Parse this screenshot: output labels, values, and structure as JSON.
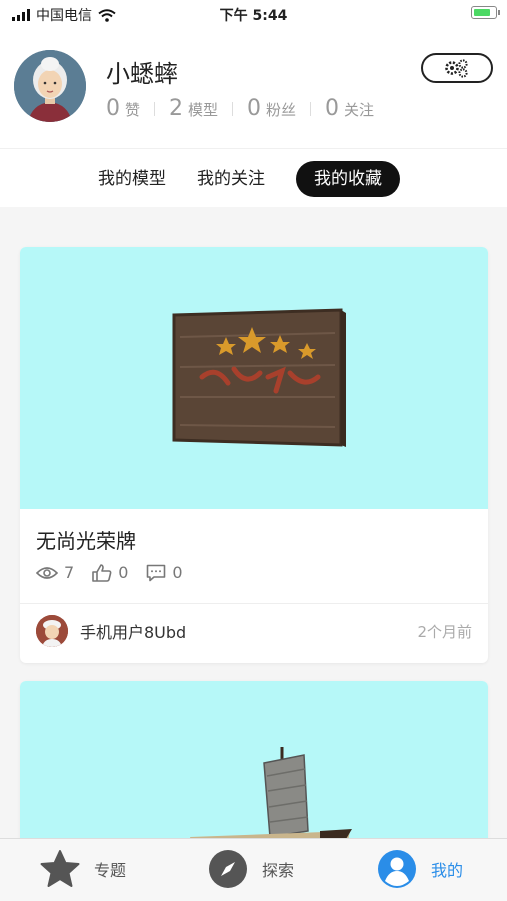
{
  "status_bar": {
    "carrier": "中国电信",
    "time": "下午 5:44"
  },
  "profile": {
    "username": "小蟋蟀",
    "stats": [
      {
        "count": "0",
        "label": "赞"
      },
      {
        "count": "2",
        "label": "模型"
      },
      {
        "count": "0",
        "label": "粉丝"
      },
      {
        "count": "0",
        "label": "关注"
      }
    ]
  },
  "tabs": [
    {
      "label": "我的模型",
      "active": false
    },
    {
      "label": "我的关注",
      "active": false
    },
    {
      "label": "我的收藏",
      "active": true
    }
  ],
  "cards": [
    {
      "title": "无尚光荣牌",
      "views": "7",
      "likes": "0",
      "comments": "0",
      "author": "手机用户8Ubd",
      "time": "2个月前",
      "image_bg": "#b6f8f8"
    },
    {
      "image_bg": "#b6f8f8"
    }
  ],
  "bottom_nav": [
    {
      "label": "专题",
      "icon": "star-icon",
      "active": false
    },
    {
      "label": "探索",
      "icon": "compass-icon",
      "active": false
    },
    {
      "label": "我的",
      "icon": "user-icon",
      "active": true
    }
  ],
  "colors": {
    "accent": "#2a8de8",
    "card_bg": "#b6f8f8",
    "active_tab": "#111111"
  }
}
